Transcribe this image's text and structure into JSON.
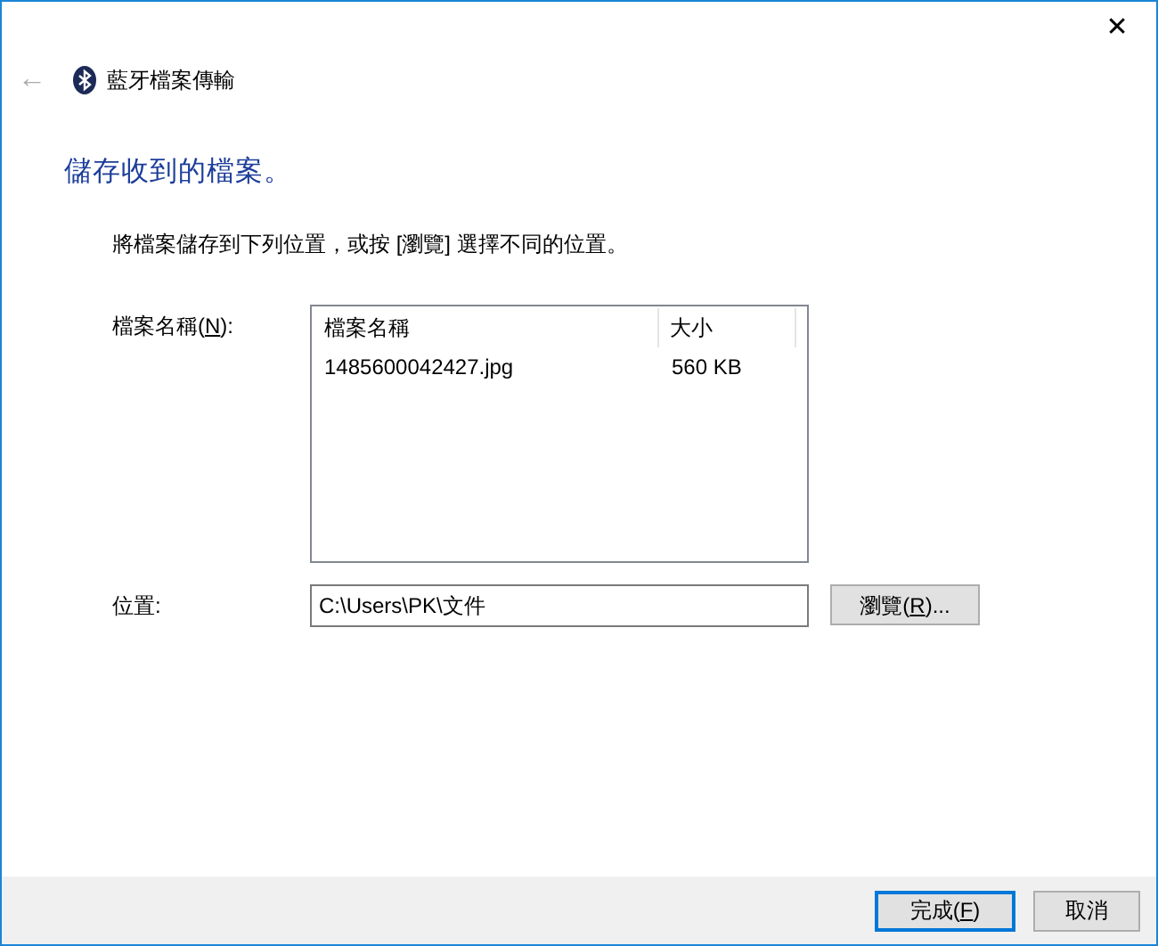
{
  "window": {
    "close": "✕",
    "back": "←",
    "title": "藍牙檔案傳輸"
  },
  "heading": "儲存收到的檔案。",
  "instruction": "將檔案儲存到下列位置，或按 [瀏覽] 選擇不同的位置。",
  "files": {
    "label": {
      "before": "檔案名稱(",
      "key": "N",
      "after": "):"
    },
    "columns": [
      "檔案名稱",
      "大小"
    ],
    "rows": [
      {
        "cells": [
          "1485600042427.jpg",
          "560 KB"
        ],
        "selected": false
      }
    ]
  },
  "location": {
    "label": "位置:",
    "value": "C:\\Users\\PK\\文件",
    "browse": {
      "before": "瀏覽(",
      "key": "R",
      "after": ")..."
    }
  },
  "buttons": [
    {
      "label": {
        "before": "完成(",
        "key": "F",
        "after": ")"
      },
      "default": true
    },
    {
      "label": {
        "before": "取消"
      },
      "default": false
    }
  ]
}
